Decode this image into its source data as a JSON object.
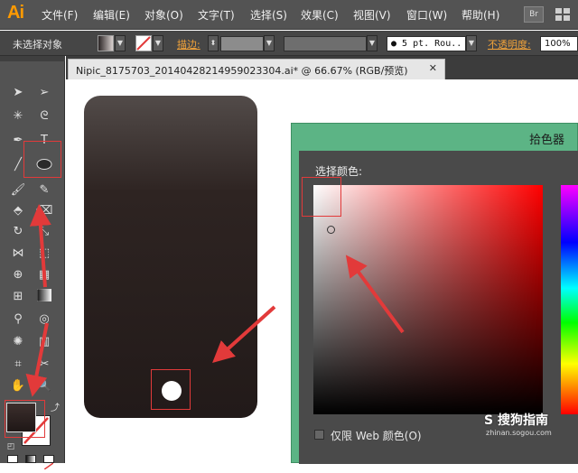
{
  "app": {
    "logo": "Ai"
  },
  "menu": {
    "items": [
      "文件(F)",
      "编辑(E)",
      "对象(O)",
      "文字(T)",
      "选择(S)",
      "效果(C)",
      "视图(V)",
      "窗口(W)",
      "帮助(H)"
    ],
    "bridge_badge": "Br"
  },
  "control_bar": {
    "selection_status": "未选择对象",
    "stroke_label": "描边:",
    "brush_preset": "● 5 pt. Rou..",
    "opacity_label": "不透明度:",
    "opacity_value": "100%"
  },
  "document": {
    "tab_label": "Nipic_8175703_20140428214959023304.ai* @ 66.67% (RGB/预览)",
    "close_glyph": "✕"
  },
  "color_picker": {
    "title": "拾色器",
    "select_color_label": "选择颜色:",
    "web_colors_label": "仅限 Web 颜色(O)",
    "web_colors_checked": false
  },
  "watermark": {
    "main": "S 搜狗指南",
    "sub": "zhinan.sogou.com"
  },
  "colors": {
    "annotation_red": "#e23a3a",
    "ai_orange": "#ff9a00",
    "picker_frame": "#5cb485"
  }
}
